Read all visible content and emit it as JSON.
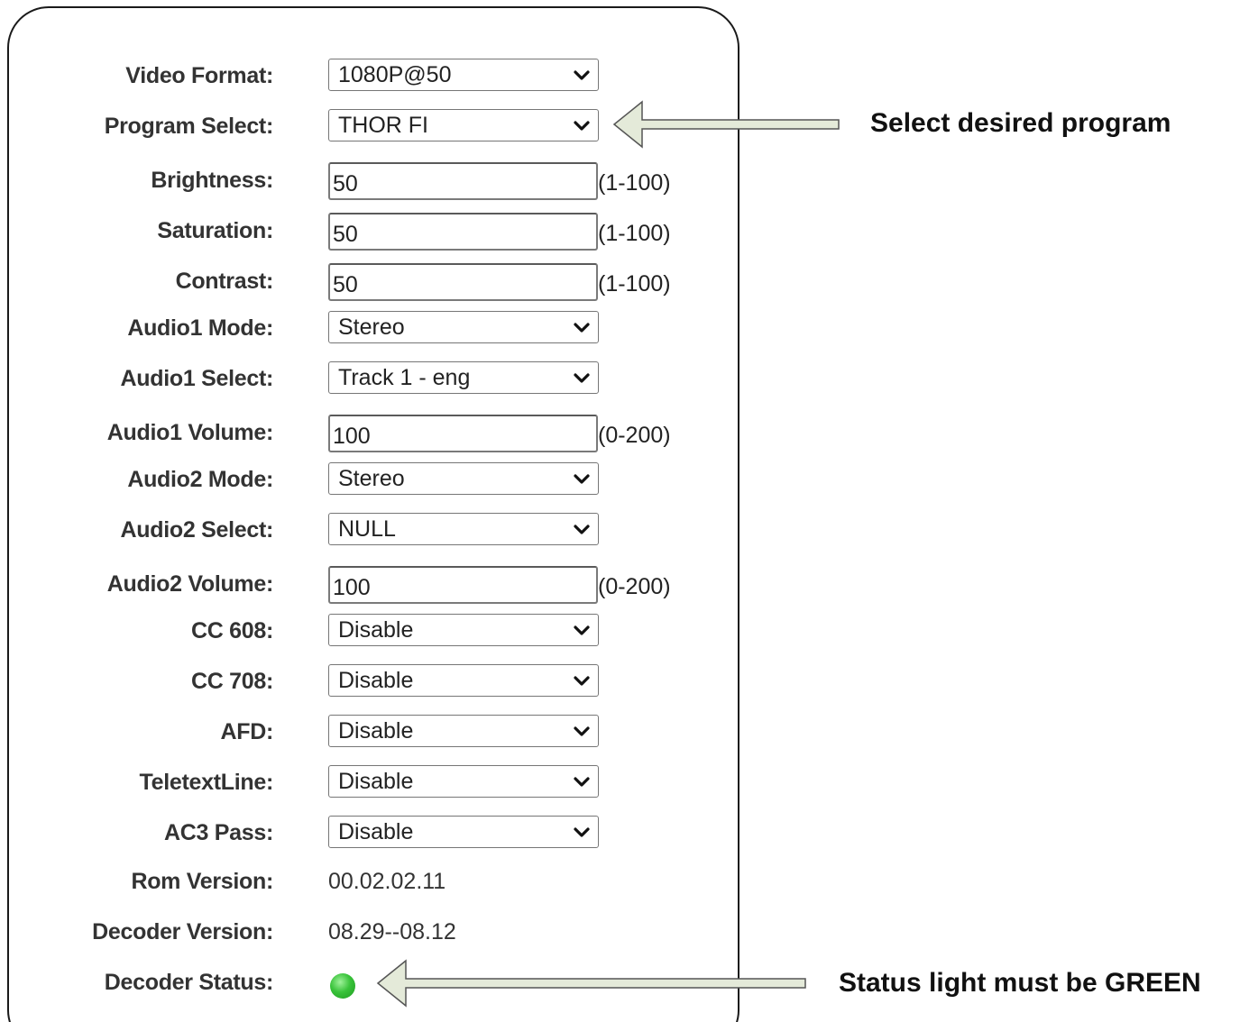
{
  "fields": [
    {
      "label": "Video Format:",
      "type": "select",
      "value": "1080P@50"
    },
    {
      "label": "Program Select:",
      "type": "select",
      "value": "THOR FI"
    },
    {
      "label": "Brightness:",
      "type": "input",
      "value": "50",
      "range": "(1-100)"
    },
    {
      "label": "Saturation:",
      "type": "input",
      "value": "50",
      "range": "(1-100)"
    },
    {
      "label": "Contrast:",
      "type": "input",
      "value": "50",
      "range": "(1-100)"
    },
    {
      "label": "Audio1 Mode:",
      "type": "select",
      "value": "Stereo"
    },
    {
      "label": "Audio1 Select:",
      "type": "select",
      "value": "Track 1 - eng"
    },
    {
      "label": "Audio1 Volume:",
      "type": "input",
      "value": "100",
      "range": "(0-200)"
    },
    {
      "label": "Audio2 Mode:",
      "type": "select",
      "value": "Stereo"
    },
    {
      "label": "Audio2 Select:",
      "type": "select",
      "value": "NULL"
    },
    {
      "label": "Audio2 Volume:",
      "type": "input",
      "value": "100",
      "range": "(0-200)"
    },
    {
      "label": "CC 608:",
      "type": "select",
      "value": "Disable"
    },
    {
      "label": "CC 708:",
      "type": "select",
      "value": "Disable"
    },
    {
      "label": "AFD:",
      "type": "select",
      "value": "Disable"
    },
    {
      "label": "TeletextLine:",
      "type": "select",
      "value": "Disable"
    },
    {
      "label": "AC3 Pass:",
      "type": "select",
      "value": "Disable"
    },
    {
      "label": "Rom Version:",
      "type": "text",
      "value": "00.02.02.11"
    },
    {
      "label": "Decoder Version:",
      "type": "text",
      "value": "08.29--08.12"
    },
    {
      "label": "Decoder Status:",
      "type": "status",
      "status_color": "green"
    }
  ],
  "annotations": {
    "program_note": "Select desired program",
    "status_note": "Status light must be GREEN",
    "arrow_fill": "#e4ead9",
    "arrow_stroke": "#555555"
  },
  "colors": {
    "status_light": "#33bf35",
    "label_text": "#333333"
  }
}
